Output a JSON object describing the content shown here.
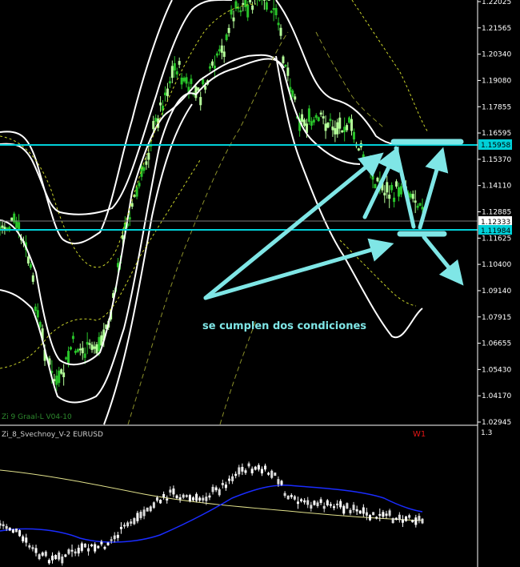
{
  "chart_data": {
    "type": "candlestick",
    "symbol": "EURUSD",
    "timeframe": "W1",
    "main_panel": {
      "indicator_label": "Zi 9 Graal-L V04-10",
      "price_ticks": [
        "1.22025",
        "1.21565",
        "1.20340",
        "1.19080",
        "1.17855",
        "1.16595",
        "1.15370",
        "1.14110",
        "1.12885",
        "1.11625",
        "1.10400",
        "1.09140",
        "1.07915",
        "1.06655",
        "1.05430",
        "1.04170",
        "1.02945"
      ],
      "horizontal_lines": [
        {
          "label": "1.15958",
          "value": 1.15958
        },
        {
          "label": "1.11984",
          "value": 1.11984
        }
      ],
      "current_price": {
        "label": "1.12333",
        "value": 1.12333
      },
      "annotation_text": "se cumplen dos condiciones",
      "colors": {
        "candles": "#29c42a",
        "candles_bright": "#b5ff9a",
        "bands": "#ffffff",
        "dashed_bands": "#c9d32a",
        "horizontal_lines": "#00d0d8",
        "arrows": "#7fe6e6"
      }
    },
    "sub_panel": {
      "indicator_label": "Zi_8_Svechnoy_V-2 EURUSD",
      "tick_top": "1.3",
      "colors": {
        "candles": "#ffffff",
        "blue_line": "#1a2cff",
        "yellow_line": "#e2e28c",
        "timeframe_label": "#e01515"
      }
    }
  }
}
